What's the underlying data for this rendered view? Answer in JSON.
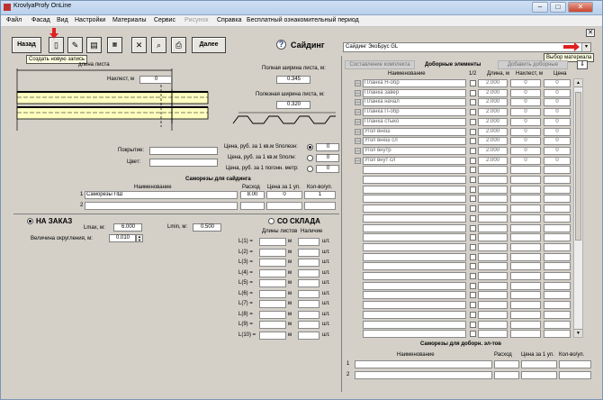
{
  "window": {
    "title": "KrovlyaProfy OnLine"
  },
  "menu": [
    "Файл",
    "Фасад",
    "Вид",
    "Настройки",
    "Материалы",
    "Сервис",
    "Рисунок",
    "Справка",
    "Бесплатный ознакомительный период"
  ],
  "toolbar": {
    "back_label": "Назад",
    "next_label": "Далее",
    "tooltip_new": "Создать новую запись",
    "section_title": "Сайдинг",
    "material_select": "Сайдинг ЭкоБрус GL",
    "tooltip_material": "Выбор материала"
  },
  "sheet": {
    "length_label": "длина листа",
    "overlap_label": "Нахлест, м",
    "overlap_value": "0",
    "full_width_label": "Полная ширина листа, м:",
    "full_width_value": "0.345",
    "useful_width_label": "Полезная ширина листа, м:",
    "useful_width_value": "0.320"
  },
  "coating": {
    "coating_label": "Покрытие:",
    "color_label": "Цвет:",
    "price_total_label": "Цена, руб. за 1 кв.м Sполезн:",
    "price_useful_label": "Цена, руб. за 1 кв.м Sполн:",
    "price_meter_label": "Цена, руб. за 1 погонн. метр:",
    "price_total": "0",
    "price_useful": "0",
    "price_meter": "0"
  },
  "screws": {
    "title": "Саморезы для сайдинга",
    "headers": [
      "Наименование",
      "Расход",
      "Цена за 1 уп.",
      "Кол-во/уп."
    ],
    "rows": [
      {
        "num": "1",
        "name": "Саморезы ПШ",
        "rate": "8.00",
        "price": "0",
        "qty": "1"
      },
      {
        "num": "2",
        "name": "",
        "rate": "",
        "price": "",
        "qty": ""
      }
    ]
  },
  "order": {
    "order_label": "НА ЗАКАЗ",
    "stock_label": "СО СКЛАДА",
    "lmax_label": "Lmax, м:",
    "lmax_value": "6.000",
    "lmin_label": "Lmin, м:",
    "lmin_value": "0.500",
    "round_label": "Величина округления, м:",
    "round_value": "0.010",
    "len_header": "Длины листов",
    "avail_header": "Наличие",
    "unit_m": "м",
    "unit_pcs": "шт.",
    "lengths": [
      "L(1) =",
      "L(2) =",
      "L(3) =",
      "L(4) =",
      "L(5) =",
      "L(6) =",
      "L(7) =",
      "L(8) =",
      "L(9) =",
      "L(10) ="
    ]
  },
  "extras": {
    "compose_button": "Составление комплекта",
    "title": "Доборные элементы",
    "add_button": "Добавить доборные",
    "headers": [
      "Наименование",
      "1/2",
      "Длина, м",
      "Нахлест, м",
      "Цена"
    ],
    "rows": [
      {
        "name": "Планка Н-обр",
        "length": "2.000",
        "overlap": "0",
        "price": "0"
      },
      {
        "name": "Планка завер",
        "length": "2.000",
        "overlap": "0",
        "price": "0"
      },
      {
        "name": "Планка начал",
        "length": "2.000",
        "overlap": "0",
        "price": "0"
      },
      {
        "name": "Планка П-обр",
        "length": "2.000",
        "overlap": "0",
        "price": "0"
      },
      {
        "name": "Планка стыко",
        "length": "2.000",
        "overlap": "0",
        "price": "0"
      },
      {
        "name": "Угол внеш",
        "length": "2.000",
        "overlap": "0",
        "price": "0"
      },
      {
        "name": "Угол внеш сл",
        "length": "2.000",
        "overlap": "0",
        "price": "0"
      },
      {
        "name": "Угол внутр",
        "length": "2.000",
        "overlap": "0",
        "price": "0"
      },
      {
        "name": "Угол внут сл",
        "length": "2.000",
        "overlap": "0",
        "price": "0"
      }
    ],
    "screws_title": "Саморезы для доборн. эл-тов",
    "screws_headers": [
      "Наименование",
      "Расход",
      "Цена за 1 уп.",
      "Кол-во/уп."
    ],
    "screws_rows": [
      "1",
      "2"
    ]
  },
  "colors": {
    "window_bg": "#d4d0c8",
    "accent_red": "#e02020"
  }
}
